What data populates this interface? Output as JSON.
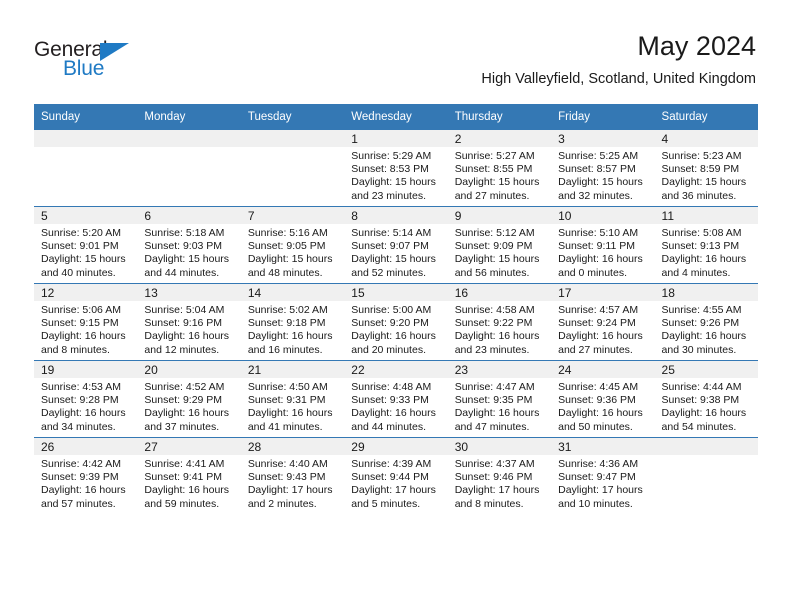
{
  "brand": {
    "name_top": "General",
    "name_bottom": "Blue",
    "accent_color": "#1f7ac4"
  },
  "header": {
    "title": "May 2024",
    "subtitle": "High Valleyfield, Scotland, United Kingdom"
  },
  "calendar": {
    "header_bg": "#3478b4",
    "daynum_bg": "#f0f0f0",
    "weekdays": [
      "Sunday",
      "Monday",
      "Tuesday",
      "Wednesday",
      "Thursday",
      "Friday",
      "Saturday"
    ],
    "weeks": [
      [
        {
          "day": "",
          "sunrise": "",
          "sunset": "",
          "daylight_1": "",
          "daylight_2": ""
        },
        {
          "day": "",
          "sunrise": "",
          "sunset": "",
          "daylight_1": "",
          "daylight_2": ""
        },
        {
          "day": "",
          "sunrise": "",
          "sunset": "",
          "daylight_1": "",
          "daylight_2": ""
        },
        {
          "day": "1",
          "sunrise": "Sunrise: 5:29 AM",
          "sunset": "Sunset: 8:53 PM",
          "daylight_1": "Daylight: 15 hours",
          "daylight_2": "and 23 minutes."
        },
        {
          "day": "2",
          "sunrise": "Sunrise: 5:27 AM",
          "sunset": "Sunset: 8:55 PM",
          "daylight_1": "Daylight: 15 hours",
          "daylight_2": "and 27 minutes."
        },
        {
          "day": "3",
          "sunrise": "Sunrise: 5:25 AM",
          "sunset": "Sunset: 8:57 PM",
          "daylight_1": "Daylight: 15 hours",
          "daylight_2": "and 32 minutes."
        },
        {
          "day": "4",
          "sunrise": "Sunrise: 5:23 AM",
          "sunset": "Sunset: 8:59 PM",
          "daylight_1": "Daylight: 15 hours",
          "daylight_2": "and 36 minutes."
        }
      ],
      [
        {
          "day": "5",
          "sunrise": "Sunrise: 5:20 AM",
          "sunset": "Sunset: 9:01 PM",
          "daylight_1": "Daylight: 15 hours",
          "daylight_2": "and 40 minutes."
        },
        {
          "day": "6",
          "sunrise": "Sunrise: 5:18 AM",
          "sunset": "Sunset: 9:03 PM",
          "daylight_1": "Daylight: 15 hours",
          "daylight_2": "and 44 minutes."
        },
        {
          "day": "7",
          "sunrise": "Sunrise: 5:16 AM",
          "sunset": "Sunset: 9:05 PM",
          "daylight_1": "Daylight: 15 hours",
          "daylight_2": "and 48 minutes."
        },
        {
          "day": "8",
          "sunrise": "Sunrise: 5:14 AM",
          "sunset": "Sunset: 9:07 PM",
          "daylight_1": "Daylight: 15 hours",
          "daylight_2": "and 52 minutes."
        },
        {
          "day": "9",
          "sunrise": "Sunrise: 5:12 AM",
          "sunset": "Sunset: 9:09 PM",
          "daylight_1": "Daylight: 15 hours",
          "daylight_2": "and 56 minutes."
        },
        {
          "day": "10",
          "sunrise": "Sunrise: 5:10 AM",
          "sunset": "Sunset: 9:11 PM",
          "daylight_1": "Daylight: 16 hours",
          "daylight_2": "and 0 minutes."
        },
        {
          "day": "11",
          "sunrise": "Sunrise: 5:08 AM",
          "sunset": "Sunset: 9:13 PM",
          "daylight_1": "Daylight: 16 hours",
          "daylight_2": "and 4 minutes."
        }
      ],
      [
        {
          "day": "12",
          "sunrise": "Sunrise: 5:06 AM",
          "sunset": "Sunset: 9:15 PM",
          "daylight_1": "Daylight: 16 hours",
          "daylight_2": "and 8 minutes."
        },
        {
          "day": "13",
          "sunrise": "Sunrise: 5:04 AM",
          "sunset": "Sunset: 9:16 PM",
          "daylight_1": "Daylight: 16 hours",
          "daylight_2": "and 12 minutes."
        },
        {
          "day": "14",
          "sunrise": "Sunrise: 5:02 AM",
          "sunset": "Sunset: 9:18 PM",
          "daylight_1": "Daylight: 16 hours",
          "daylight_2": "and 16 minutes."
        },
        {
          "day": "15",
          "sunrise": "Sunrise: 5:00 AM",
          "sunset": "Sunset: 9:20 PM",
          "daylight_1": "Daylight: 16 hours",
          "daylight_2": "and 20 minutes."
        },
        {
          "day": "16",
          "sunrise": "Sunrise: 4:58 AM",
          "sunset": "Sunset: 9:22 PM",
          "daylight_1": "Daylight: 16 hours",
          "daylight_2": "and 23 minutes."
        },
        {
          "day": "17",
          "sunrise": "Sunrise: 4:57 AM",
          "sunset": "Sunset: 9:24 PM",
          "daylight_1": "Daylight: 16 hours",
          "daylight_2": "and 27 minutes."
        },
        {
          "day": "18",
          "sunrise": "Sunrise: 4:55 AM",
          "sunset": "Sunset: 9:26 PM",
          "daylight_1": "Daylight: 16 hours",
          "daylight_2": "and 30 minutes."
        }
      ],
      [
        {
          "day": "19",
          "sunrise": "Sunrise: 4:53 AM",
          "sunset": "Sunset: 9:28 PM",
          "daylight_1": "Daylight: 16 hours",
          "daylight_2": "and 34 minutes."
        },
        {
          "day": "20",
          "sunrise": "Sunrise: 4:52 AM",
          "sunset": "Sunset: 9:29 PM",
          "daylight_1": "Daylight: 16 hours",
          "daylight_2": "and 37 minutes."
        },
        {
          "day": "21",
          "sunrise": "Sunrise: 4:50 AM",
          "sunset": "Sunset: 9:31 PM",
          "daylight_1": "Daylight: 16 hours",
          "daylight_2": "and 41 minutes."
        },
        {
          "day": "22",
          "sunrise": "Sunrise: 4:48 AM",
          "sunset": "Sunset: 9:33 PM",
          "daylight_1": "Daylight: 16 hours",
          "daylight_2": "and 44 minutes."
        },
        {
          "day": "23",
          "sunrise": "Sunrise: 4:47 AM",
          "sunset": "Sunset: 9:35 PM",
          "daylight_1": "Daylight: 16 hours",
          "daylight_2": "and 47 minutes."
        },
        {
          "day": "24",
          "sunrise": "Sunrise: 4:45 AM",
          "sunset": "Sunset: 9:36 PM",
          "daylight_1": "Daylight: 16 hours",
          "daylight_2": "and 50 minutes."
        },
        {
          "day": "25",
          "sunrise": "Sunrise: 4:44 AM",
          "sunset": "Sunset: 9:38 PM",
          "daylight_1": "Daylight: 16 hours",
          "daylight_2": "and 54 minutes."
        }
      ],
      [
        {
          "day": "26",
          "sunrise": "Sunrise: 4:42 AM",
          "sunset": "Sunset: 9:39 PM",
          "daylight_1": "Daylight: 16 hours",
          "daylight_2": "and 57 minutes."
        },
        {
          "day": "27",
          "sunrise": "Sunrise: 4:41 AM",
          "sunset": "Sunset: 9:41 PM",
          "daylight_1": "Daylight: 16 hours",
          "daylight_2": "and 59 minutes."
        },
        {
          "day": "28",
          "sunrise": "Sunrise: 4:40 AM",
          "sunset": "Sunset: 9:43 PM",
          "daylight_1": "Daylight: 17 hours",
          "daylight_2": "and 2 minutes."
        },
        {
          "day": "29",
          "sunrise": "Sunrise: 4:39 AM",
          "sunset": "Sunset: 9:44 PM",
          "daylight_1": "Daylight: 17 hours",
          "daylight_2": "and 5 minutes."
        },
        {
          "day": "30",
          "sunrise": "Sunrise: 4:37 AM",
          "sunset": "Sunset: 9:46 PM",
          "daylight_1": "Daylight: 17 hours",
          "daylight_2": "and 8 minutes."
        },
        {
          "day": "31",
          "sunrise": "Sunrise: 4:36 AM",
          "sunset": "Sunset: 9:47 PM",
          "daylight_1": "Daylight: 17 hours",
          "daylight_2": "and 10 minutes."
        },
        {
          "day": "",
          "sunrise": "",
          "sunset": "",
          "daylight_1": "",
          "daylight_2": ""
        }
      ]
    ]
  }
}
